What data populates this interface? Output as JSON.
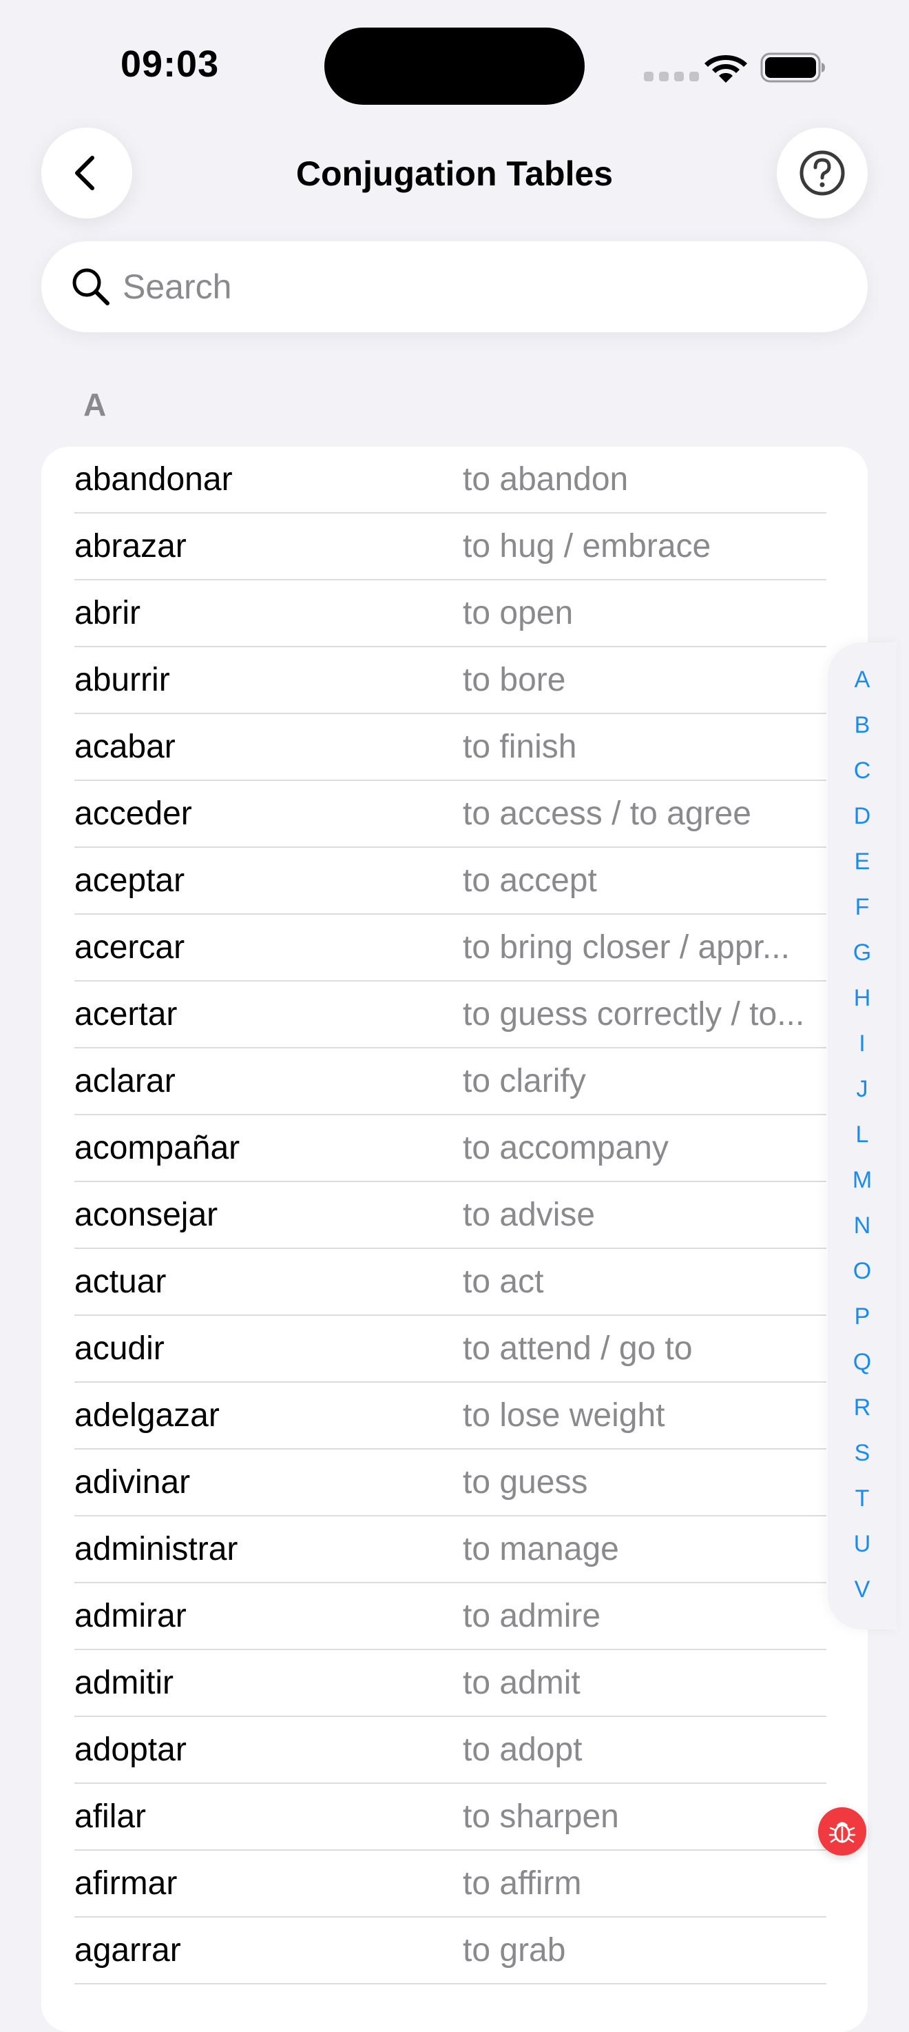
{
  "status_bar": {
    "time": "09:03"
  },
  "nav": {
    "title": "Conjugation Tables",
    "back_icon": "chevron-left-icon",
    "help_icon": "question-circle-icon"
  },
  "search": {
    "placeholder": "Search",
    "value": ""
  },
  "section": {
    "header": "A"
  },
  "verbs": [
    {
      "verb": "abandonar",
      "translation": "to abandon"
    },
    {
      "verb": "abrazar",
      "translation": "to hug / embrace"
    },
    {
      "verb": "abrir",
      "translation": "to open"
    },
    {
      "verb": "aburrir",
      "translation": "to bore"
    },
    {
      "verb": "acabar",
      "translation": "to finish"
    },
    {
      "verb": "acceder",
      "translation": "to access / to agree"
    },
    {
      "verb": "aceptar",
      "translation": "to accept"
    },
    {
      "verb": "acercar",
      "translation": "to bring closer / appr..."
    },
    {
      "verb": "acertar",
      "translation": "to guess correctly / to..."
    },
    {
      "verb": "aclarar",
      "translation": "to clarify"
    },
    {
      "verb": "acompañar",
      "translation": "to accompany"
    },
    {
      "verb": "aconsejar",
      "translation": "to advise"
    },
    {
      "verb": "actuar",
      "translation": "to act"
    },
    {
      "verb": "acudir",
      "translation": "to attend / go to"
    },
    {
      "verb": "adelgazar",
      "translation": "to lose weight"
    },
    {
      "verb": "adivinar",
      "translation": "to guess"
    },
    {
      "verb": "administrar",
      "translation": "to manage"
    },
    {
      "verb": "admirar",
      "translation": "to admire"
    },
    {
      "verb": "admitir",
      "translation": "to admit"
    },
    {
      "verb": "adoptar",
      "translation": "to adopt"
    },
    {
      "verb": "afilar",
      "translation": "to sharpen"
    },
    {
      "verb": "afirmar",
      "translation": "to affirm"
    },
    {
      "verb": "agarrar",
      "translation": "to grab"
    }
  ],
  "index_letters": [
    "A",
    "B",
    "C",
    "D",
    "E",
    "F",
    "G",
    "H",
    "I",
    "J",
    "L",
    "M",
    "N",
    "O",
    "P",
    "Q",
    "R",
    "S",
    "T",
    "U",
    "V"
  ],
  "colors": {
    "background": "#f2f2f7",
    "accent": "#1a8cf0",
    "secondary_text": "#8a8a8e",
    "debug": "#f03a3f"
  }
}
